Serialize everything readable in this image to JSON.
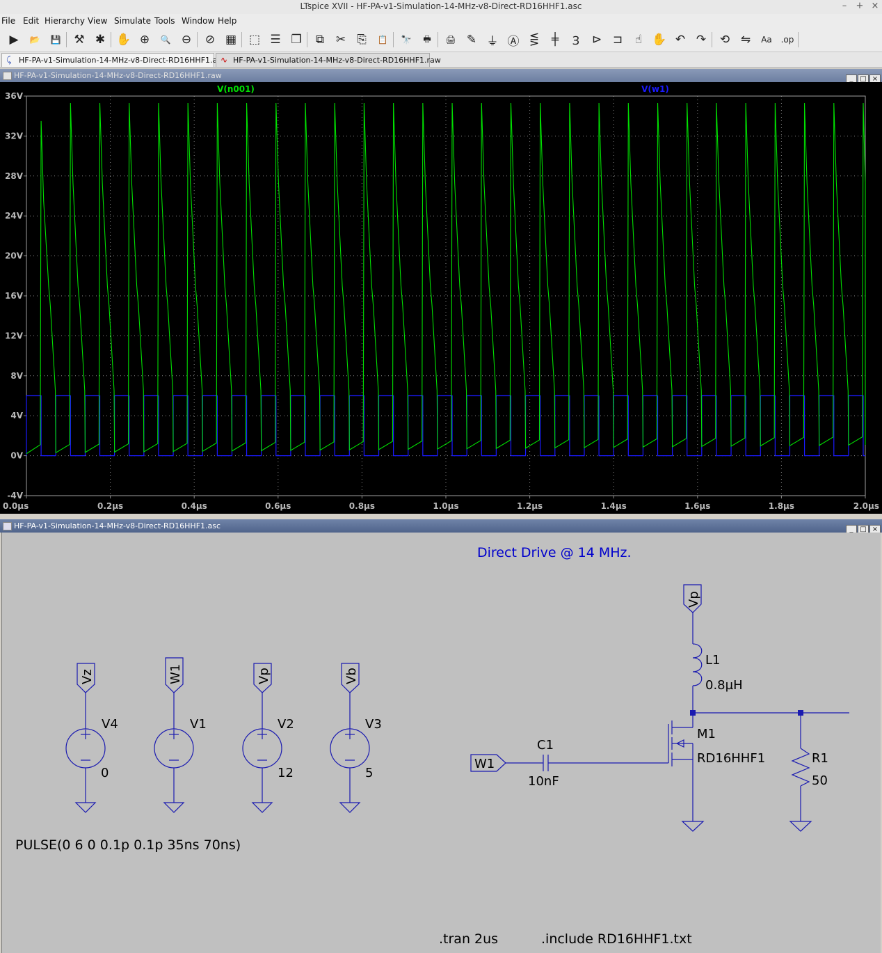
{
  "app": {
    "window_title": "LTspice XVII - HF-PA-v1-Simulation-14-MHz-v8-Direct-RD16HHF1.asc",
    "controls": {
      "minimize": "–",
      "maximize": "+",
      "close": "×"
    }
  },
  "menu": {
    "items": [
      {
        "label": "File"
      },
      {
        "label": "Edit"
      },
      {
        "label": "Hierarchy"
      },
      {
        "label": "View"
      },
      {
        "label": "Simulate"
      },
      {
        "label": "Tools"
      },
      {
        "label": "Window"
      },
      {
        "label": "Help"
      }
    ]
  },
  "toolbar": {
    "buttons": [
      {
        "name": "run-icon",
        "glyph": "▶"
      },
      {
        "name": "open-icon",
        "glyph": "📂"
      },
      {
        "name": "save-icon",
        "glyph": "💾"
      },
      {
        "name": "control-panel-icon",
        "glyph": "⚒"
      },
      {
        "name": "halt-icon",
        "glyph": "✱"
      },
      {
        "name": "pan-icon",
        "glyph": "✋"
      },
      {
        "name": "zoom-in-icon",
        "glyph": "⊕"
      },
      {
        "name": "zoom-area-icon",
        "glyph": "🔍"
      },
      {
        "name": "zoom-out-icon",
        "glyph": "⊖"
      },
      {
        "name": "zoom-cancel-icon",
        "glyph": "⊘"
      },
      {
        "name": "autorange-icon",
        "glyph": "▦"
      },
      {
        "name": "mark-icon",
        "glyph": "⬚"
      },
      {
        "name": "tile-horizontal-icon",
        "glyph": "☰"
      },
      {
        "name": "cascade-icon",
        "glyph": "❐"
      },
      {
        "name": "tile-vertical-icon",
        "glyph": "⧉"
      },
      {
        "name": "cut-icon",
        "glyph": "✂"
      },
      {
        "name": "copy-icon",
        "glyph": "⎘"
      },
      {
        "name": "paste-icon",
        "glyph": "📋"
      },
      {
        "name": "find-icon",
        "glyph": "🔭"
      },
      {
        "name": "print-preview-icon",
        "glyph": "🖶"
      },
      {
        "name": "print-icon",
        "glyph": "🖨"
      },
      {
        "name": "draw-wire-icon",
        "glyph": "✎"
      },
      {
        "name": "ground-icon",
        "glyph": "⏚"
      },
      {
        "name": "label-net-icon",
        "glyph": "Ⓐ"
      },
      {
        "name": "resistor-icon",
        "glyph": "⋚"
      },
      {
        "name": "capacitor-icon",
        "glyph": "╪"
      },
      {
        "name": "inductor-icon",
        "glyph": "Ɜ"
      },
      {
        "name": "diode-icon",
        "glyph": "⊳"
      },
      {
        "name": "component-icon",
        "glyph": "⊐"
      },
      {
        "name": "move-icon",
        "glyph": "☝"
      },
      {
        "name": "drag-icon",
        "glyph": "✋"
      },
      {
        "name": "undo-icon",
        "glyph": "↶"
      },
      {
        "name": "redo-icon",
        "glyph": "↷"
      },
      {
        "name": "rotate-icon",
        "glyph": "⟲"
      },
      {
        "name": "mirror-icon",
        "glyph": "⇋"
      },
      {
        "name": "text-icon",
        "glyph": "Aa"
      },
      {
        "name": "spice-directive-icon",
        "glyph": ".op"
      }
    ]
  },
  "tabs": [
    {
      "label": "HF-PA-v1-Simulation-14-MHz-v8-Direct-RD16HHF1.asc",
      "active": true
    },
    {
      "label": "HF-PA-v1-Simulation-14-MHz-v8-Direct-RD16HHF1.raw",
      "active": false
    }
  ],
  "plot_window": {
    "title": "HF-PA-v1-Simulation-14-MHz-v8-Direct-RD16HHF1.raw",
    "background": "#000000",
    "grid_color": "#8a8a8a"
  },
  "chart_data": {
    "type": "line",
    "title": "",
    "xlabel": "",
    "ylabel": "",
    "xlim": [
      0,
      2.0
    ],
    "ylim": [
      -4,
      36
    ],
    "x_ticks": [
      "0.0µs",
      "0.2µs",
      "0.4µs",
      "0.6µs",
      "0.8µs",
      "1.0µs",
      "1.2µs",
      "1.4µs",
      "1.6µs",
      "1.8µs",
      "2.0µs"
    ],
    "y_ticks": [
      "36V",
      "32V",
      "28V",
      "24V",
      "20V",
      "16V",
      "12V",
      "8V",
      "4V",
      "0V",
      "-4V"
    ],
    "series": [
      {
        "name": "V(n001)",
        "color": "#00e000",
        "period_us": 0.07,
        "first_peak_v": 33.5,
        "peak_v": 35.3,
        "knee_v": 15.0,
        "baseline_start_v": 0.2,
        "baseline_end_v": 1.0
      },
      {
        "name": "V(w1)",
        "color": "#1a1aff",
        "period_us": 0.07,
        "high_v": 6,
        "low_v": 0,
        "pulse_width_us": 0.035
      }
    ]
  },
  "schematic_window": {
    "title": "HF-PA-v1-Simulation-14-MHz-v8-Direct-RD16HHF1.asc",
    "comment": "Direct Drive @ 14 MHz.",
    "sources": [
      {
        "net": "Vz",
        "ref": "V4",
        "value": "0"
      },
      {
        "net": "W1",
        "ref": "V1",
        "value": ""
      },
      {
        "net": "Vp",
        "ref": "V2",
        "value": "12"
      },
      {
        "net": "Vb",
        "ref": "V3",
        "value": "5"
      }
    ],
    "pulse_text": "PULSE(0 6 0 0.1p 0.1p 35ns 70ns)",
    "input_net": "W1",
    "c1": {
      "ref": "C1",
      "value": "10nF"
    },
    "supply_net": "Vp",
    "l1": {
      "ref": "L1",
      "value": "0.8µH"
    },
    "m1": {
      "ref": "M1",
      "value": "RD16HHF1"
    },
    "r1": {
      "ref": "R1",
      "value": "50"
    },
    "tran_directive": ".tran 2us",
    "include_directive": ".include RD16HHF1.txt",
    "wire_color": "#1a1ab0",
    "comment_color": "#0000cc"
  }
}
